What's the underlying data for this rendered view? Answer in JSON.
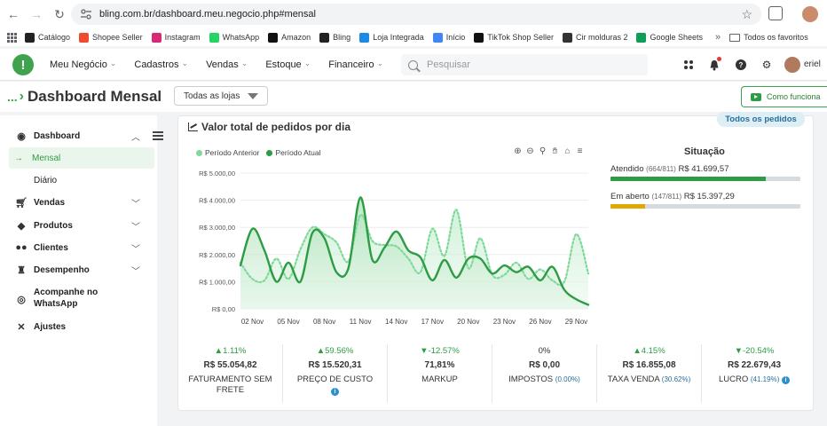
{
  "browser": {
    "url": "bling.com.br/dashboard.meu.negocio.php#mensal",
    "bookmarks": [
      "Catálogo",
      "Shopee Seller",
      "Instagram",
      "WhatsApp",
      "Amazon",
      "Bling",
      "Loja Integrada",
      "Início",
      "TikTok Shop Seller",
      "Cir molduras 2",
      "Google Sheets"
    ],
    "bookmark_colors": [
      "#222222",
      "#ee4d2d",
      "#d62976",
      "#25d366",
      "#111111",
      "#222222",
      "#1e88e5",
      "#4285f4",
      "#111111",
      "#333333",
      "#0f9d58"
    ],
    "folder": "Todos os favoritos"
  },
  "header": {
    "logo": "!",
    "menu": [
      "Meu Negócio",
      "Cadastros",
      "Vendas",
      "Estoque",
      "Financeiro"
    ],
    "search_placeholder": "Pesquisar",
    "user_name": "eriel"
  },
  "page": {
    "title": "Dashboard Mensal",
    "store_filter": "Todas as lojas",
    "how_it_works": "Como funciona"
  },
  "sidebar": {
    "items": [
      {
        "label": "Dashboard",
        "icon": "dashboard-icon"
      },
      {
        "label": "Mensal",
        "icon": "arrow-right-icon"
      },
      {
        "label": "Diário"
      },
      {
        "label": "Vendas",
        "icon": "cart-icon"
      },
      {
        "label": "Produtos",
        "icon": "tag-icon"
      },
      {
        "label": "Clientes",
        "icon": "users-icon"
      },
      {
        "label": "Desempenho",
        "icon": "trophy-icon"
      },
      {
        "label": "Acompanhe no",
        "label2": "WhatsApp",
        "icon": "whatsapp-icon"
      },
      {
        "label": "Ajustes",
        "icon": "tools-icon"
      }
    ]
  },
  "card": {
    "title": "Valor total de pedidos por dia",
    "filter_badge": "Todos os pedidos"
  },
  "situacao": {
    "title": "Situação",
    "rows": [
      {
        "label": "Atendido",
        "count": "(664/811)",
        "value": "R$ 41.699,57",
        "fraction": 0.8188,
        "color": "#2e9c45"
      },
      {
        "label": "Em aberto",
        "count": "(147/811)",
        "value": "R$ 15.397,29",
        "fraction": 0.1813,
        "color": "#e0a800"
      }
    ]
  },
  "kpis": [
    {
      "change": "▲1.11%",
      "value": "R$ 55.054,82",
      "label": "FATURAMENTO SEM",
      "label2": "FRETE",
      "pct": "",
      "info": false
    },
    {
      "change": "▲59.56%",
      "value": "R$ 15.520,31",
      "label": "PREÇO DE CUSTO",
      "label2": "",
      "pct": "",
      "info": true
    },
    {
      "change": "▼-12.57%",
      "value": "71,81%",
      "label": "MARKUP",
      "label2": "",
      "pct": "",
      "info": false
    },
    {
      "change": "0%",
      "value": "R$ 0,00",
      "label": "IMPOSTOS",
      "label2": "",
      "pct": "(0.00%)",
      "info": false
    },
    {
      "change": "▲4.15%",
      "value": "R$ 16.855,08",
      "label": "TAXA VENDA",
      "label2": "",
      "pct": "(30.62%)",
      "info": false
    },
    {
      "change": "▼-20.54%",
      "value": "R$ 22.679,43",
      "label": "LUCRO",
      "label2": "",
      "pct": "(41.19%)",
      "info": true
    }
  ],
  "chart_data": {
    "type": "area",
    "ylim": [
      0,
      5000
    ],
    "yticks": [
      "R$ 0,00",
      "R$ 1.000,00",
      "R$ 2.000,00",
      "R$ 3.000,00",
      "R$ 4.000,00",
      "R$ 5.000,00"
    ],
    "x_tick_labels": [
      "02 Nov",
      "05 Nov",
      "08 Nov",
      "11 Nov",
      "14 Nov",
      "17 Nov",
      "20 Nov",
      "23 Nov",
      "26 Nov",
      "29 Nov"
    ],
    "x": [
      "01 Nov",
      "02 Nov",
      "03 Nov",
      "04 Nov",
      "05 Nov",
      "06 Nov",
      "07 Nov",
      "08 Nov",
      "09 Nov",
      "10 Nov",
      "11 Nov",
      "12 Nov",
      "13 Nov",
      "14 Nov",
      "15 Nov",
      "16 Nov",
      "17 Nov",
      "18 Nov",
      "19 Nov",
      "20 Nov",
      "21 Nov",
      "22 Nov",
      "23 Nov",
      "24 Nov",
      "25 Nov",
      "26 Nov",
      "27 Nov",
      "28 Nov",
      "29 Nov",
      "30 Nov"
    ],
    "series": [
      {
        "name": "Período Anterior",
        "color": "#7fd99a",
        "dashed": true,
        "values": [
          1700,
          1100,
          1050,
          1850,
          1100,
          2200,
          3000,
          2750,
          2450,
          1750,
          3450,
          2500,
          2350,
          2300,
          1850,
          1350,
          2950,
          1950,
          3650,
          1500,
          2600,
          1250,
          1250,
          1700,
          1100,
          1450,
          1050,
          1000,
          2750,
          1300
        ]
      },
      {
        "name": "Período Atual",
        "color": "#2e9c45",
        "dashed": false,
        "values": [
          1600,
          2950,
          2150,
          1000,
          1700,
          1000,
          2800,
          2600,
          1350,
          1500,
          4100,
          1800,
          2250,
          2850,
          2150,
          1900,
          1050,
          1800,
          1150,
          1850,
          1850,
          1300,
          1600,
          1350,
          1550,
          1050,
          1550,
          700,
          350,
          150
        ]
      }
    ]
  }
}
